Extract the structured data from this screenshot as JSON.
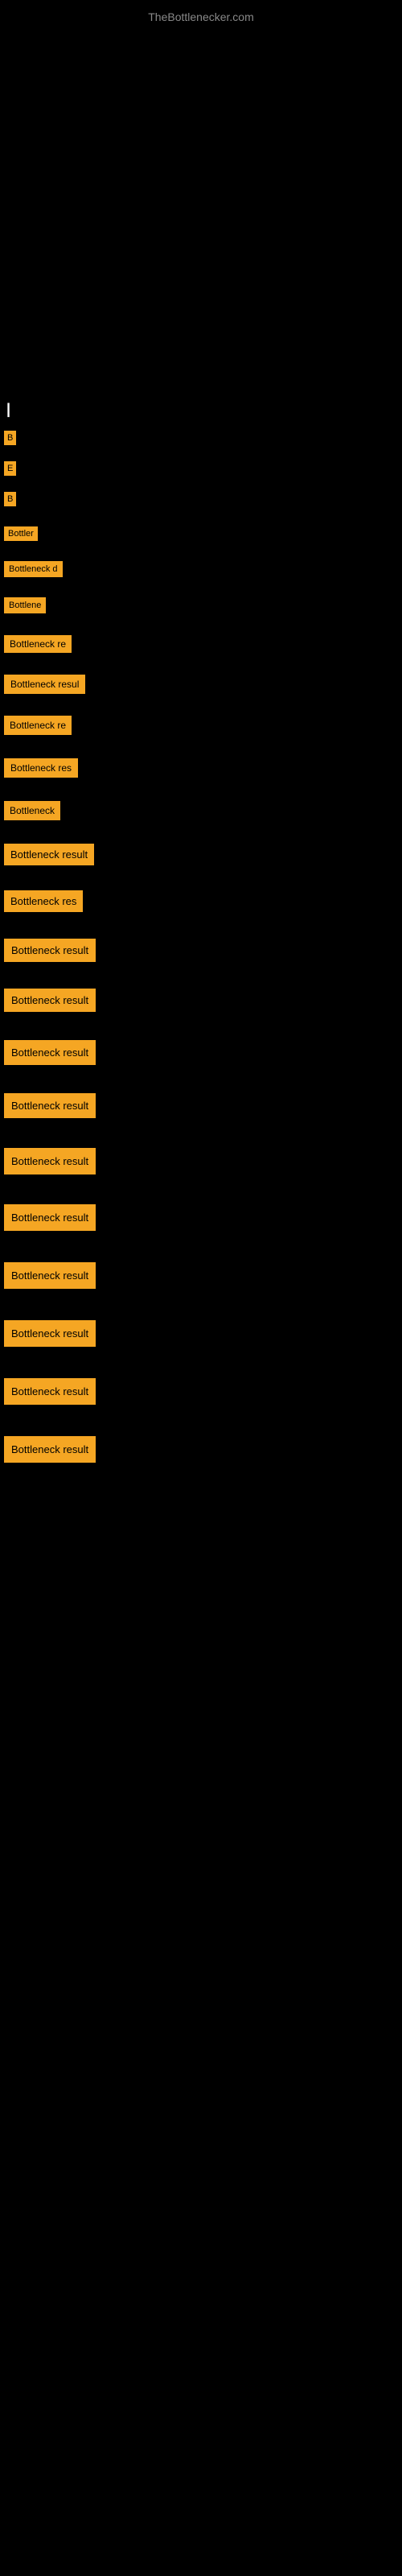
{
  "site": {
    "title": "TheBottlenecker.com"
  },
  "cursor": {
    "symbol": "|"
  },
  "items": [
    {
      "id": 1,
      "label": "B",
      "truncated": true
    },
    {
      "id": 2,
      "label": "E",
      "truncated": true
    },
    {
      "id": 3,
      "label": "B",
      "truncated": true
    },
    {
      "id": 4,
      "label": "Bottler",
      "truncated": true
    },
    {
      "id": 5,
      "label": "Bottleneck d",
      "truncated": true
    },
    {
      "id": 6,
      "label": "Bottlene",
      "truncated": true
    },
    {
      "id": 7,
      "label": "Bottleneck re",
      "truncated": true
    },
    {
      "id": 8,
      "label": "Bottleneck resul",
      "truncated": true
    },
    {
      "id": 9,
      "label": "Bottleneck re",
      "truncated": true
    },
    {
      "id": 10,
      "label": "Bottleneck res",
      "truncated": true
    },
    {
      "id": 11,
      "label": "Bottleneck",
      "truncated": true
    },
    {
      "id": 12,
      "label": "Bottleneck result",
      "truncated": false
    },
    {
      "id": 13,
      "label": "Bottleneck res",
      "truncated": false
    },
    {
      "id": 14,
      "label": "Bottleneck result",
      "truncated": false
    },
    {
      "id": 15,
      "label": "Bottleneck result",
      "truncated": false
    },
    {
      "id": 16,
      "label": "Bottleneck result",
      "truncated": false
    },
    {
      "id": 17,
      "label": "Bottleneck result",
      "truncated": false
    },
    {
      "id": 18,
      "label": "Bottleneck result",
      "truncated": false
    },
    {
      "id": 19,
      "label": "Bottleneck result",
      "truncated": false
    },
    {
      "id": 20,
      "label": "Bottleneck result",
      "truncated": false
    },
    {
      "id": 21,
      "label": "Bottleneck result",
      "truncated": false
    },
    {
      "id": 22,
      "label": "Bottleneck result",
      "truncated": false
    },
    {
      "id": 23,
      "label": "Bottleneck result",
      "truncated": false
    }
  ]
}
